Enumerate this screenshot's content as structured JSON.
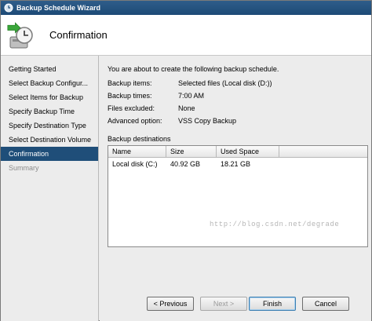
{
  "window": {
    "title": "Backup Schedule Wizard"
  },
  "header": {
    "title": "Confirmation"
  },
  "nav": {
    "items": [
      {
        "label": "Getting Started",
        "state": "normal"
      },
      {
        "label": "Select Backup Configur...",
        "state": "normal"
      },
      {
        "label": "Select Items for Backup",
        "state": "normal"
      },
      {
        "label": "Specify Backup Time",
        "state": "normal"
      },
      {
        "label": "Specify Destination Type",
        "state": "normal"
      },
      {
        "label": "Select Destination Volume",
        "state": "normal"
      },
      {
        "label": "Confirmation",
        "state": "active"
      },
      {
        "label": "Summary",
        "state": "disabled"
      }
    ]
  },
  "content": {
    "intro": "You are about to create the following backup schedule.",
    "details": [
      {
        "key": "Backup items:",
        "value": "Selected files (Local disk (D:))"
      },
      {
        "key": "Backup times:",
        "value": "7:00 AM"
      },
      {
        "key": "Files excluded:",
        "value": "None"
      },
      {
        "key": "Advanced option:",
        "value": "VSS Copy Backup"
      }
    ],
    "destinations_label": "Backup destinations",
    "table": {
      "columns": [
        "Name",
        "Size",
        "Used Space"
      ],
      "rows": [
        [
          "Local disk (C:)",
          "40.92 GB",
          "18.21 GB"
        ]
      ]
    },
    "watermark": "http://blog.csdn.net/degrade"
  },
  "buttons": {
    "previous": "< Previous",
    "next": "Next >",
    "finish": "Finish",
    "cancel": "Cancel"
  },
  "colors": {
    "titlebar": "#1d4a76",
    "nav_active": "#1f4e79"
  }
}
